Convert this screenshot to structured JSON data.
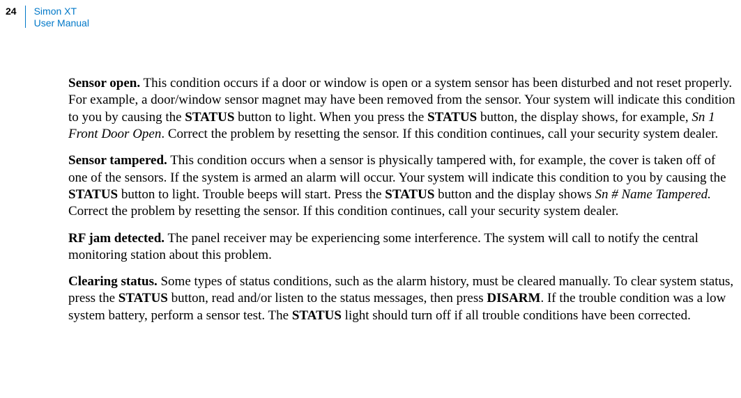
{
  "header": {
    "page_number": "24",
    "title_line1": "Simon XT",
    "title_line2": "User Manual"
  },
  "paragraphs": {
    "p1_heading": "Sensor open.",
    "p1_text_a": "  This condition occurs if a door or window is open or a system sensor has been disturbed and not reset properly. For example, a door/window sensor magnet may have been removed from the sensor. Your system will indicate this condition to you by causing the ",
    "p1_bold_a": "STATUS",
    "p1_text_b": " button to light. When you press the ",
    "p1_bold_b": "STATUS",
    "p1_text_c": " button, the display shows, for example, ",
    "p1_italic_a": "Sn 1 Front Door Open",
    "p1_text_d": ". Correct the problem by resetting the sensor. If this condition continues, call your security system dealer.",
    "p2_heading": "Sensor tampered.",
    "p2_text_a": "  This condition occurs when a sensor is physically tampered with, for example, the cover is taken off of one of the sensors. If the system is armed an alarm will occur. Your system will indicate this condition to you by causing the ",
    "p2_bold_a": "STATUS",
    "p2_text_b": " button to light. Trouble beeps will start. Press the ",
    "p2_bold_b": "STATUS",
    "p2_text_c": " button and the display shows ",
    "p2_italic_a": "Sn # Name Tampered.",
    "p2_text_d": " Correct the problem by resetting the sensor. If this condition continues, call your security system dealer.",
    "p3_heading": "RF jam detected.",
    "p3_text_a": "  The panel receiver may be experiencing some interference. The system will call to notify the central monitoring station about this problem.",
    "p4_heading": "Clearing status.",
    "p4_text_a": "  Some types of status conditions, such as the alarm history, must be cleared manually. To clear system status, press the ",
    "p4_bold_a": "STATUS",
    "p4_text_b": " button, read and/or listen to the status messages, then press ",
    "p4_bold_b": "DISARM",
    "p4_text_c": ". If the trouble condition was a low system battery, perform a sensor test. The ",
    "p4_bold_c": "STATUS",
    "p4_text_d": " light should turn off if all trouble conditions have been corrected."
  }
}
